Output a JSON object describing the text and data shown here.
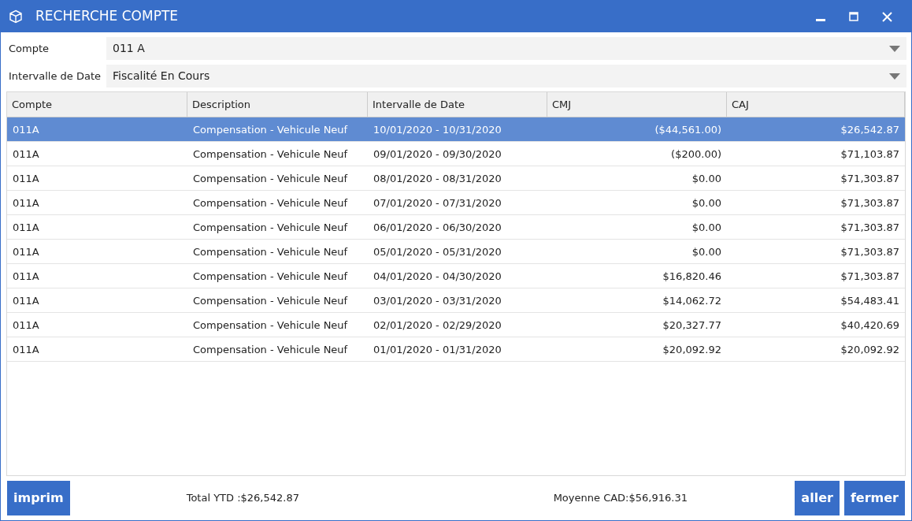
{
  "window": {
    "title": "RECHERCHE COMPTE"
  },
  "filters": [
    {
      "label": "Compte",
      "value": "011 A"
    },
    {
      "label": "Intervalle de Date",
      "value": "Fiscalité En Cours"
    }
  ],
  "table": {
    "columns": [
      "Compte",
      "Description",
      "Intervalle de Date",
      "CMJ",
      "CAJ"
    ],
    "rows": [
      {
        "cells": [
          "011A",
          "Compensation - Vehicule Neuf",
          "10/01/2020 - 10/31/2020",
          "($44,561.00)",
          "$26,542.87"
        ],
        "selected": true
      },
      {
        "cells": [
          "011A",
          "Compensation - Vehicule Neuf",
          "09/01/2020 - 09/30/2020",
          "($200.00)",
          "$71,103.87"
        ],
        "selected": false
      },
      {
        "cells": [
          "011A",
          "Compensation - Vehicule Neuf",
          "08/01/2020 - 08/31/2020",
          "$0.00",
          "$71,303.87"
        ],
        "selected": false
      },
      {
        "cells": [
          "011A",
          "Compensation - Vehicule Neuf",
          "07/01/2020 - 07/31/2020",
          "$0.00",
          "$71,303.87"
        ],
        "selected": false
      },
      {
        "cells": [
          "011A",
          "Compensation - Vehicule Neuf",
          "06/01/2020 - 06/30/2020",
          "$0.00",
          "$71,303.87"
        ],
        "selected": false
      },
      {
        "cells": [
          "011A",
          "Compensation - Vehicule Neuf",
          "05/01/2020 - 05/31/2020",
          "$0.00",
          "$71,303.87"
        ],
        "selected": false
      },
      {
        "cells": [
          "011A",
          "Compensation - Vehicule Neuf",
          "04/01/2020 - 04/30/2020",
          "$16,820.46",
          "$71,303.87"
        ],
        "selected": false
      },
      {
        "cells": [
          "011A",
          "Compensation - Vehicule Neuf",
          "03/01/2020 - 03/31/2020",
          "$14,062.72",
          "$54,483.41"
        ],
        "selected": false
      },
      {
        "cells": [
          "011A",
          "Compensation - Vehicule Neuf",
          "02/01/2020 - 02/29/2020",
          "$20,327.77",
          "$40,420.69"
        ],
        "selected": false
      },
      {
        "cells": [
          "011A",
          "Compensation - Vehicule Neuf",
          "01/01/2020 - 01/31/2020",
          "$20,092.92",
          "$20,092.92"
        ],
        "selected": false
      }
    ]
  },
  "footer": {
    "print_button": "imprim",
    "total": "Total YTD :$26,542.87",
    "average": "Moyenne CAD:$56,916.31",
    "buttons": [
      "aller",
      "fermer"
    ]
  }
}
